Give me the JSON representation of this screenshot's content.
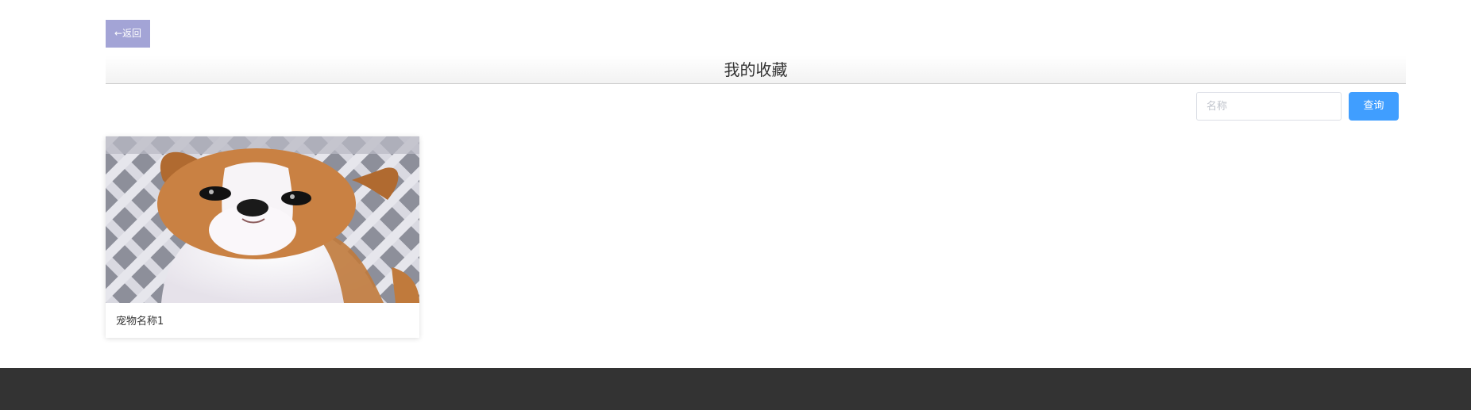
{
  "back_button": {
    "label": "←返回"
  },
  "page_title": "我的收藏",
  "search": {
    "placeholder": "名称",
    "value": ""
  },
  "query_button": {
    "label": "查询"
  },
  "favorites": [
    {
      "name": "宠物名称1",
      "image": "puppy-photo"
    }
  ],
  "colors": {
    "back_button_bg": "#a3a4d6",
    "query_button_bg": "#409eff",
    "footer_bg": "#333333"
  }
}
